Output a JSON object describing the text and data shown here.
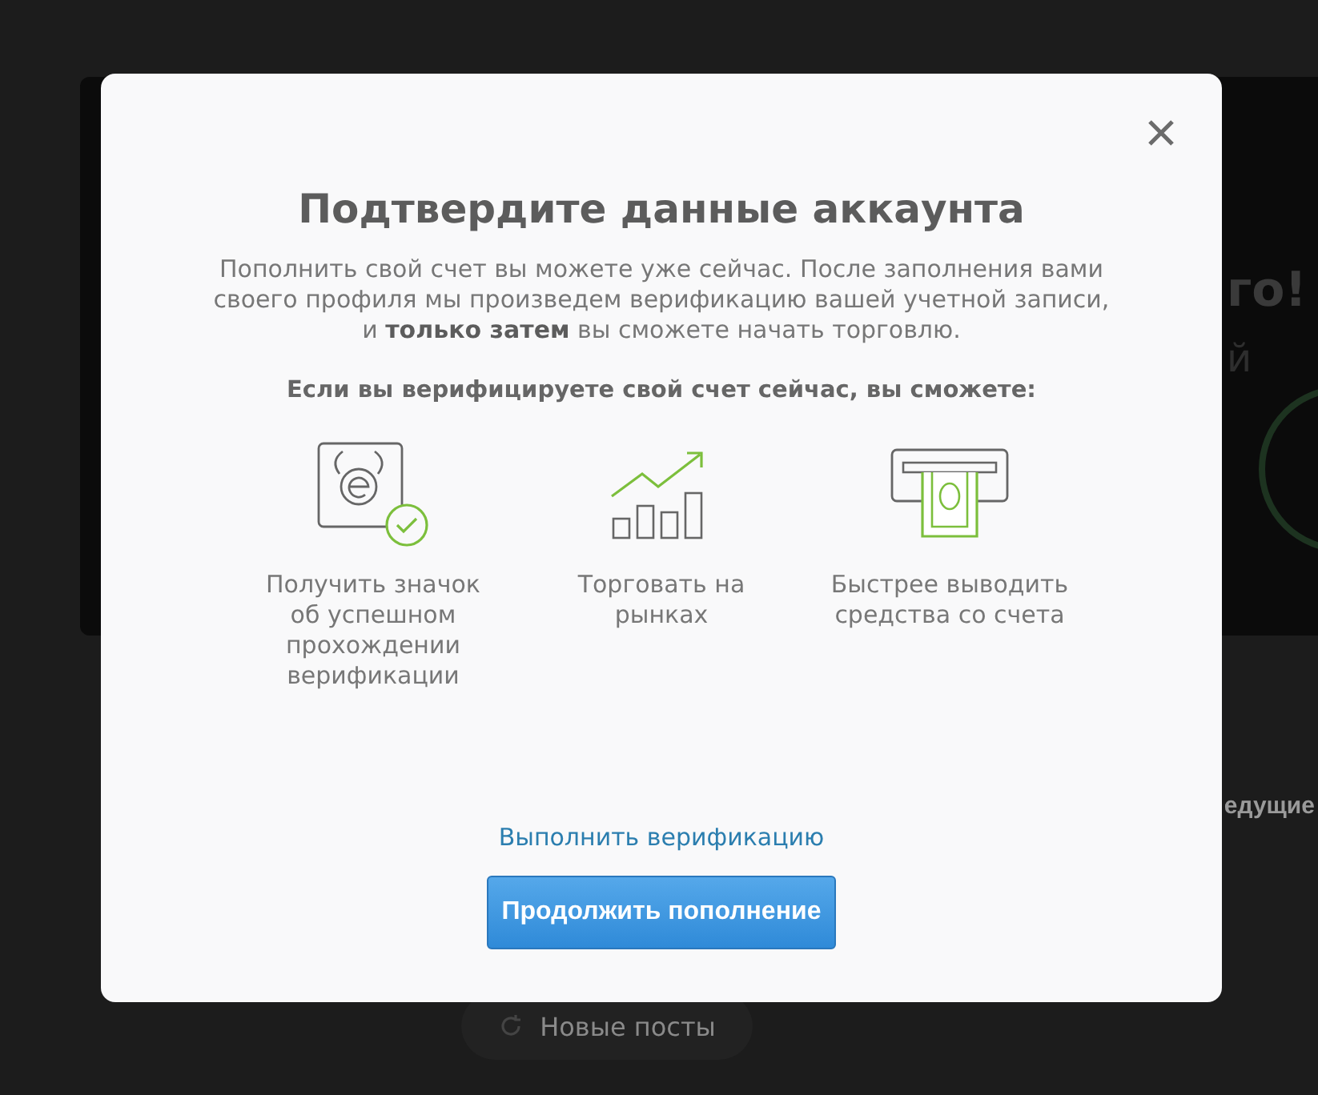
{
  "background": {
    "banner_texts": [
      "го!",
      "й"
    ],
    "section_heading": "едущие",
    "new_posts_button": "Новые посты"
  },
  "modal": {
    "title": "Подтвердите данные аккаунта",
    "description": "Пополнить свой счет вы можете уже сейчас. После заполнения вами своего профиля мы произведем верификацию вашей учетной записи, и **только затем** вы сможете начать торговлю.",
    "subheading": "Если вы верифицируете свой счет сейчас, вы сможете:",
    "features": [
      {
        "kind": "badge",
        "label": "Получить значок об успешном прохождении верификации"
      },
      {
        "kind": "chart",
        "label": "Торговать на рынках"
      },
      {
        "kind": "cash",
        "label": "Быстрее выводить средства со счета"
      }
    ],
    "link": "Выполнить верификацию",
    "button": "Продолжить пополнение"
  }
}
